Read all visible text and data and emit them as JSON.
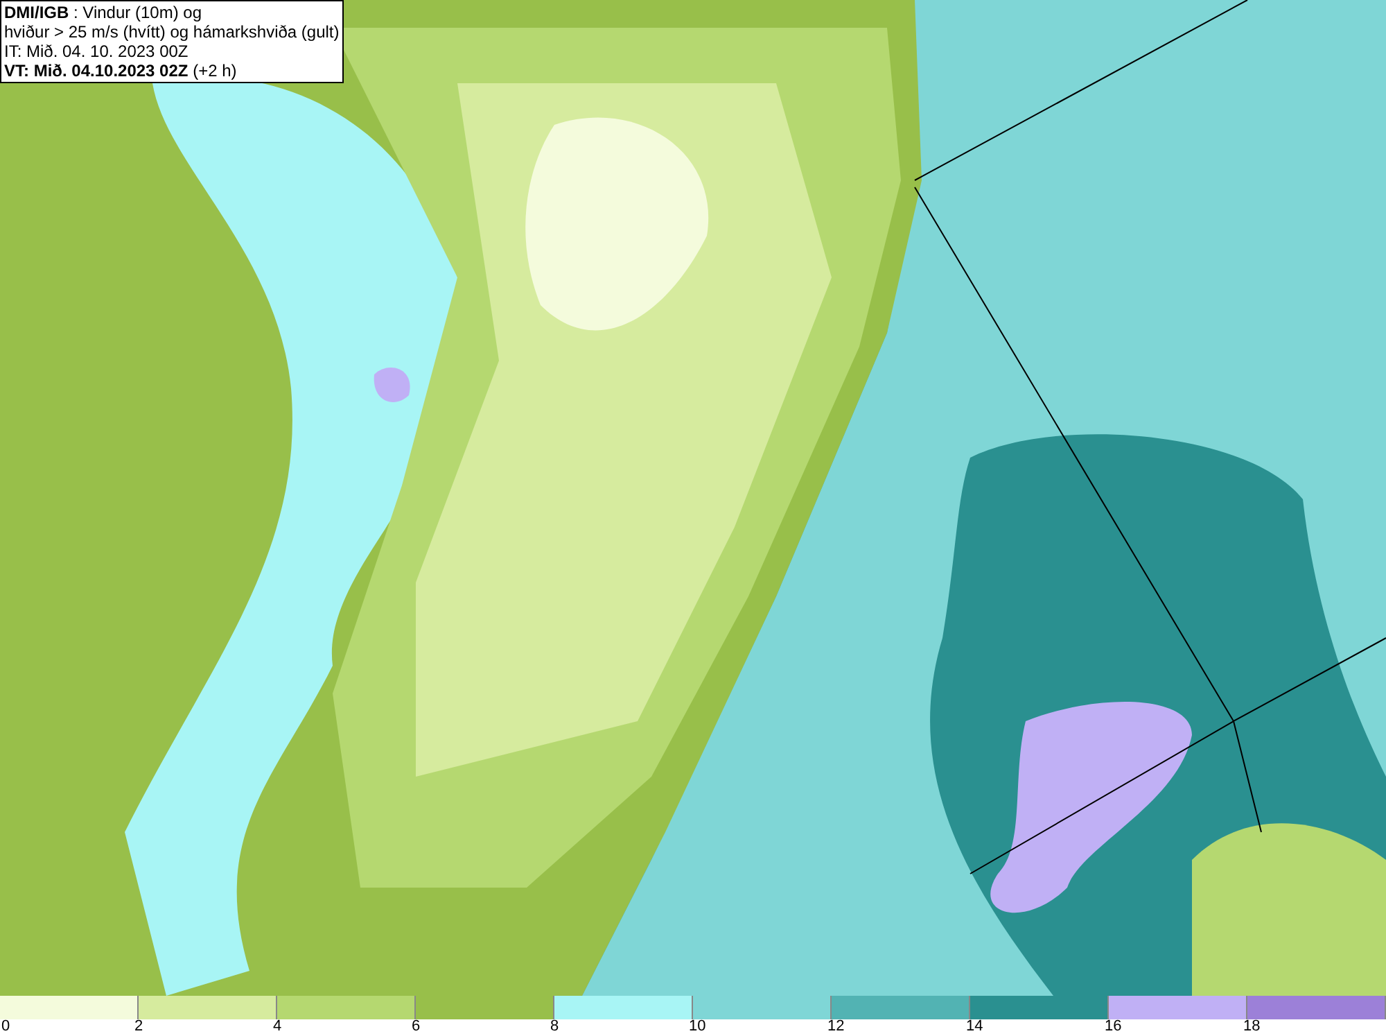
{
  "title_box": {
    "lines": [
      "**DMI/IGB** : Vindur (10m) og",
      "hviður > 25 m/s (hvítt) og hámarkshviða (gult)",
      "IT: Mið. 04. 10. 2023 00Z",
      "**VT: Mið. 04.10.2023 02Z** (+2 h)"
    ]
  },
  "legend": {
    "bins": [
      {
        "color": "#f4fbdc"
      },
      {
        "color": "#d6eb9e"
      },
      {
        "color": "#b5d870"
      },
      {
        "color": "#98bf4a"
      },
      {
        "color": "#a8f5f5"
      },
      {
        "color": "#7fd6d6"
      },
      {
        "color": "#52b3b3"
      },
      {
        "color": "#2a9090"
      },
      {
        "color": "#c0b0f5"
      },
      {
        "color": "#9c80d8"
      }
    ],
    "ticks": [
      "0",
      "2",
      "4",
      "6",
      "8",
      "10",
      "12",
      "14",
      "16",
      "18"
    ]
  }
}
